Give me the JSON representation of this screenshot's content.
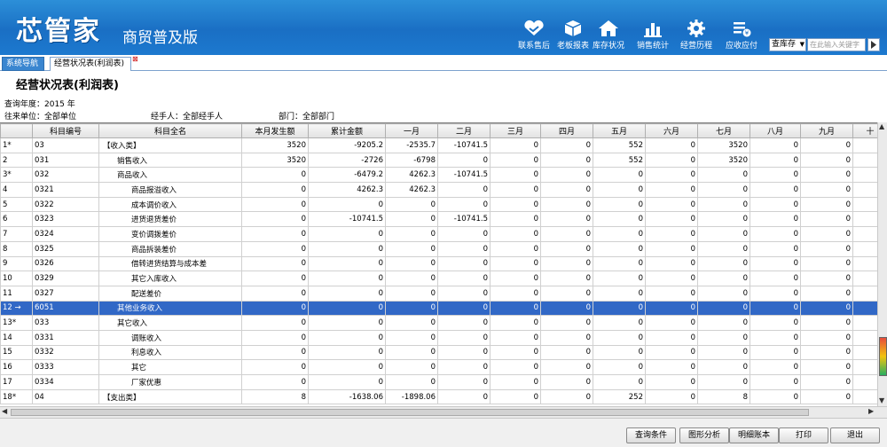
{
  "app": {
    "logo": "芯管家",
    "edition": "商贸普及版"
  },
  "toolbar": [
    {
      "label": "联系售后",
      "icon": "heart-handshake-icon"
    },
    {
      "label": "老板报表",
      "icon": "cube-icon"
    },
    {
      "label": "库存状况",
      "icon": "home-icon"
    },
    {
      "label": "销售统计",
      "icon": "bar-chart-icon"
    },
    {
      "label": "经营历程",
      "icon": "gear-icon"
    },
    {
      "label": "应收应付",
      "icon": "list-money-icon"
    }
  ],
  "search": {
    "selected": "查库存",
    "placeholder": "在此输入关键字"
  },
  "tabs": {
    "nav": "系统导航",
    "current": "经营状况表(利润表)"
  },
  "page": {
    "title": "经营状况表(利润表)",
    "year_label": "查询年度：2015 年",
    "unit_label": "往来单位：全部单位",
    "handler_label": "经手人：全部经手人",
    "dept_label": "部门：全部部门"
  },
  "columns": [
    "",
    "科目编号",
    "科目全名",
    "本月发生额",
    "累计金额",
    "一月",
    "二月",
    "三月",
    "四月",
    "五月",
    "六月",
    "七月",
    "八月",
    "九月",
    "十"
  ],
  "rows": [
    {
      "idx": "1*",
      "code": "03",
      "name": "【收入类】",
      "indent": 0,
      "vals": [
        "3520",
        "-9205.2",
        "-2535.7",
        "-10741.5",
        "0",
        "0",
        "552",
        "0",
        "3520",
        "0",
        "0"
      ]
    },
    {
      "idx": "2",
      "code": "031",
      "name": "销售收入",
      "indent": 1,
      "vals": [
        "3520",
        "-2726",
        "-6798",
        "0",
        "0",
        "0",
        "552",
        "0",
        "3520",
        "0",
        "0"
      ]
    },
    {
      "idx": "3*",
      "code": "032",
      "name": "商品收入",
      "indent": 1,
      "vals": [
        "0",
        "-6479.2",
        "4262.3",
        "-10741.5",
        "0",
        "0",
        "0",
        "0",
        "0",
        "0",
        "0"
      ]
    },
    {
      "idx": "4",
      "code": "0321",
      "name": "商品报溢收入",
      "indent": 2,
      "vals": [
        "0",
        "4262.3",
        "4262.3",
        "0",
        "0",
        "0",
        "0",
        "0",
        "0",
        "0",
        "0"
      ]
    },
    {
      "idx": "5",
      "code": "0322",
      "name": "成本调价收入",
      "indent": 2,
      "vals": [
        "0",
        "0",
        "0",
        "0",
        "0",
        "0",
        "0",
        "0",
        "0",
        "0",
        "0"
      ]
    },
    {
      "idx": "6",
      "code": "0323",
      "name": "进货退货差价",
      "indent": 2,
      "vals": [
        "0",
        "-10741.5",
        "0",
        "-10741.5",
        "0",
        "0",
        "0",
        "0",
        "0",
        "0",
        "0"
      ]
    },
    {
      "idx": "7",
      "code": "0324",
      "name": "变价调拨差价",
      "indent": 2,
      "vals": [
        "0",
        "0",
        "0",
        "0",
        "0",
        "0",
        "0",
        "0",
        "0",
        "0",
        "0"
      ]
    },
    {
      "idx": "8",
      "code": "0325",
      "name": "商品拆装差价",
      "indent": 2,
      "vals": [
        "0",
        "0",
        "0",
        "0",
        "0",
        "0",
        "0",
        "0",
        "0",
        "0",
        "0"
      ]
    },
    {
      "idx": "9",
      "code": "0326",
      "name": "借转进货结算与成本差",
      "indent": 2,
      "vals": [
        "0",
        "0",
        "0",
        "0",
        "0",
        "0",
        "0",
        "0",
        "0",
        "0",
        "0"
      ]
    },
    {
      "idx": "10",
      "code": "0329",
      "name": "其它入库收入",
      "indent": 2,
      "vals": [
        "0",
        "0",
        "0",
        "0",
        "0",
        "0",
        "0",
        "0",
        "0",
        "0",
        "0"
      ]
    },
    {
      "idx": "11",
      "code": "0327",
      "name": "配送差价",
      "indent": 2,
      "vals": [
        "0",
        "0",
        "0",
        "0",
        "0",
        "0",
        "0",
        "0",
        "0",
        "0",
        "0"
      ]
    },
    {
      "idx": "12 →",
      "code": "6051",
      "name": "其他业务收入",
      "indent": 1,
      "vals": [
        "0",
        "0",
        "0",
        "0",
        "0",
        "0",
        "0",
        "0",
        "0",
        "0",
        "0"
      ],
      "selected": true
    },
    {
      "idx": "13*",
      "code": "033",
      "name": "其它收入",
      "indent": 1,
      "vals": [
        "0",
        "0",
        "0",
        "0",
        "0",
        "0",
        "0",
        "0",
        "0",
        "0",
        "0"
      ]
    },
    {
      "idx": "14",
      "code": "0331",
      "name": "调账收入",
      "indent": 2,
      "vals": [
        "0",
        "0",
        "0",
        "0",
        "0",
        "0",
        "0",
        "0",
        "0",
        "0",
        "0"
      ]
    },
    {
      "idx": "15",
      "code": "0332",
      "name": "利息收入",
      "indent": 2,
      "vals": [
        "0",
        "0",
        "0",
        "0",
        "0",
        "0",
        "0",
        "0",
        "0",
        "0",
        "0"
      ]
    },
    {
      "idx": "16",
      "code": "0333",
      "name": "其它",
      "indent": 2,
      "vals": [
        "0",
        "0",
        "0",
        "0",
        "0",
        "0",
        "0",
        "0",
        "0",
        "0",
        "0"
      ]
    },
    {
      "idx": "17",
      "code": "0334",
      "name": "厂家优惠",
      "indent": 2,
      "vals": [
        "0",
        "0",
        "0",
        "0",
        "0",
        "0",
        "0",
        "0",
        "0",
        "0",
        "0"
      ]
    },
    {
      "idx": "18*",
      "code": "04",
      "name": "【支出类】",
      "indent": 0,
      "vals": [
        "8",
        "-1638.06",
        "-1898.06",
        "0",
        "0",
        "0",
        "252",
        "0",
        "8",
        "0",
        "0"
      ]
    }
  ],
  "footer_buttons": [
    "查询条件",
    "图形分析",
    "明细账本",
    "打印",
    "退出"
  ]
}
